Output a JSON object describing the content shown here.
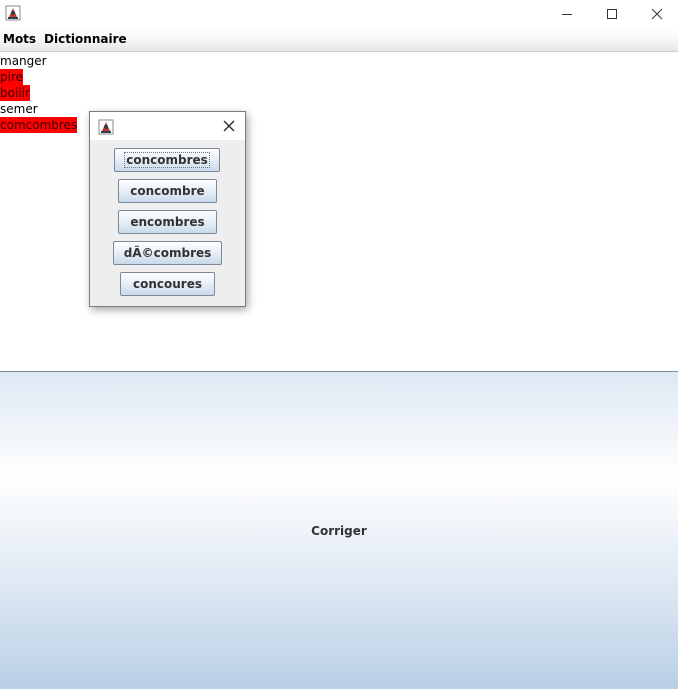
{
  "window": {
    "icon": "java-cup-icon",
    "controls": [
      "minimize-icon",
      "maximize-icon",
      "close-icon"
    ]
  },
  "menu": {
    "mots": "Mots",
    "dictionnaire": "Dictionnaire"
  },
  "words": [
    {
      "text": "manger",
      "misspelled": false
    },
    {
      "text": "pire",
      "misspelled": true
    },
    {
      "text": "boilir",
      "misspelled": true
    },
    {
      "text": "semer",
      "misspelled": false
    },
    {
      "text": "comcombres",
      "misspelled": true
    }
  ],
  "dialog": {
    "icon": "java-cup-icon",
    "close": "close-icon",
    "suggestions": [
      "concombres",
      "concombre",
      "encombres",
      "dÃ©combres",
      "concoures"
    ],
    "focused_index": 0
  },
  "corriger": {
    "label": "Corriger"
  },
  "colors": {
    "error_highlight": "#ff0000",
    "panel_gradient_bottom": "#b9cfe6"
  }
}
